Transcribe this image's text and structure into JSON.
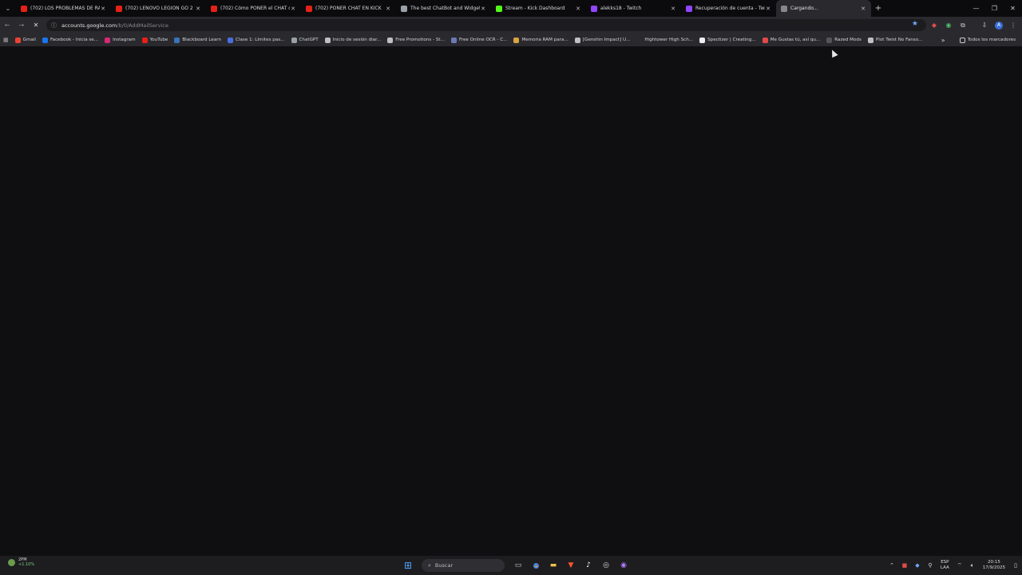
{
  "tabs": [
    {
      "title": "(702) LOS PROBLEMAS DE RAG",
      "favicon_color": "#e62117",
      "icon": "youtube-icon"
    },
    {
      "title": "(702) LENOVO LEGION GO 2 tu",
      "favicon_color": "#e62117",
      "icon": "youtube-icon"
    },
    {
      "title": "(702) Cómo PONER el CHAT de",
      "favicon_color": "#e62117",
      "icon": "youtube-icon"
    },
    {
      "title": "(702) PONER CHAT EN KICK",
      "favicon_color": "#e62117",
      "icon": "youtube-icon"
    },
    {
      "title": "The best ChatBot and Widgets",
      "favicon_color": "#9aa0a6",
      "icon": "botrix-icon"
    },
    {
      "title": "Stream - Kick Dashboard",
      "favicon_color": "#53fc18",
      "icon": "kick-icon"
    },
    {
      "title": "alekks18 - Twitch",
      "favicon_color": "#9146ff",
      "icon": "twitch-icon"
    },
    {
      "title": "Recuperación de cuenta - Twit",
      "favicon_color": "#9146ff",
      "icon": "twitch-icon"
    },
    {
      "title": "Cargando...",
      "favicon_color": "#888888",
      "icon": "loading-icon",
      "active": true
    }
  ],
  "address": {
    "host": "accounts.google.com",
    "path": "/b/0/AddMailService"
  },
  "bookmarks": [
    {
      "label": "Gmail",
      "color": "#ea4335"
    },
    {
      "label": "Facebook - Inicia se...",
      "color": "#1877f2"
    },
    {
      "label": "Instagram",
      "color": "#d62976"
    },
    {
      "label": "YouTube",
      "color": "#e62117"
    },
    {
      "label": "Blackboard Learn",
      "color": "#3b73b9"
    },
    {
      "label": "Clase 1: Límites pas...",
      "color": "#4a6ee0"
    },
    {
      "label": "ChatGPT",
      "color": "#9aa0a6"
    },
    {
      "label": "Inicio de sesión diar...",
      "color": "#c0c0c0"
    },
    {
      "label": "Free Promotions - St...",
      "color": "#c0c0c0"
    },
    {
      "label": "Free Online OCR - C...",
      "color": "#6b7bb8"
    },
    {
      "label": "Memoria RAM para...",
      "color": "#d9a441"
    },
    {
      "label": "[Genshin Impact] U...",
      "color": "#c0c0c0"
    },
    {
      "label": "Hightower High Sch...",
      "color": "#2a2a2e"
    },
    {
      "label": "Spectizer | Creating...",
      "color": "#eeeeee"
    },
    {
      "label": "Me Gustas tú, así qu...",
      "color": "#e24a4a"
    },
    {
      "label": "Razed Mods",
      "color": "#555555"
    },
    {
      "label": "Plot Twist No Fanso...",
      "color": "#c0c0c0"
    }
  ],
  "bookmarks_overflow": "»",
  "all_bookmarks_label": "Todos los marcadores",
  "weather": {
    "temp": "2PM",
    "change": "+1.10%"
  },
  "taskbar": {
    "search_placeholder": "Buscar"
  },
  "tray": {
    "lang_top": "ESP",
    "lang_bottom": "LAA",
    "time": "20:15",
    "date": "17/9/2025"
  }
}
